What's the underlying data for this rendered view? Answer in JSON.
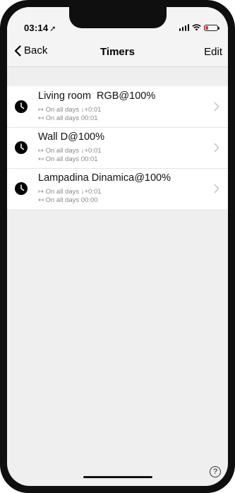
{
  "status_bar": {
    "time": "03:14",
    "location_glyph": "➚",
    "icons": [
      "signal-icon",
      "wifi-icon",
      "battery-icon"
    ],
    "battery_color": "#e5342f"
  },
  "nav": {
    "back_label": "Back",
    "title": "Timers",
    "edit_label": "Edit"
  },
  "timers": [
    {
      "name": "Living room  RGB@100%",
      "line1": "↦ On all days ↓+0:01",
      "line2": "↤ On all days 00:01"
    },
    {
      "name": "Wall D@100%",
      "line1": "↦ On all days ↓+0:01",
      "line2": "↤ On all days 00:01"
    },
    {
      "name": "Lampadina Dinamica@100%",
      "line1": "↦ On all days ↓+0:01",
      "line2": "↤ On all days 00:00"
    }
  ],
  "help_label": "?"
}
